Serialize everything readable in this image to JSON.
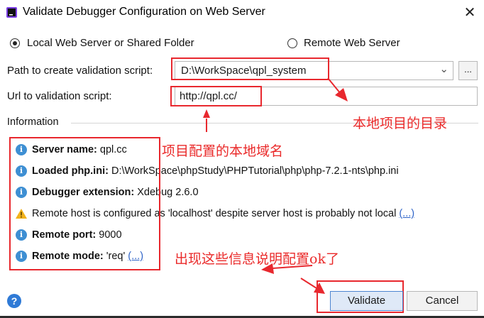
{
  "window": {
    "title": "Validate Debugger Configuration on Web Server",
    "close_label": "✕"
  },
  "mode": {
    "local_label": "Local Web Server or Shared Folder",
    "remote_label": "Remote Web Server",
    "selected": "local"
  },
  "path": {
    "label": "Path to create validation script:",
    "value": "D:\\WorkSpace\\qpl_system",
    "browse_label": "..."
  },
  "url": {
    "label": "Url to validation script:",
    "value": "http://qpl.cc/"
  },
  "information": {
    "title": "Information",
    "lines": [
      {
        "type": "info",
        "key": "Server name:",
        "value": " qpl.cc"
      },
      {
        "type": "info",
        "key": "Loaded php.ini:",
        "value": " D:\\WorkSpace\\phpStudy\\PHPTutorial\\php\\php-7.2.1-nts\\php.ini"
      },
      {
        "type": "info",
        "key": "Debugger extension:",
        "value": " Xdebug 2.6.0"
      },
      {
        "type": "warning",
        "key": "",
        "value": "Remote host is configured as 'localhost' despite server host is probably not local",
        "link": "(...)"
      },
      {
        "type": "info",
        "key": "Remote port:",
        "value": " 9000"
      },
      {
        "type": "info",
        "key": "Remote mode:",
        "value": " 'req'",
        "link": "(...)"
      }
    ]
  },
  "buttons": {
    "validate": "Validate",
    "cancel": "Cancel",
    "help": "?"
  },
  "annotations": {
    "local_dir": "本地项目的目录",
    "local_domain": "项目配置的本地域名",
    "config_ok": "出现这些信息说明配置ok了"
  },
  "colors": {
    "annotation_red": "#e8282e",
    "info_blue": "#3e8fd3",
    "link_blue": "#2f64c8",
    "warning_yellow": "#f2b21b"
  }
}
